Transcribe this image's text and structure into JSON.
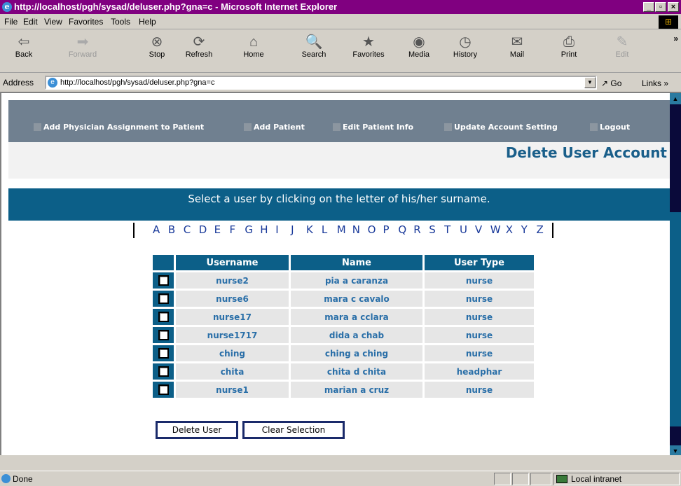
{
  "window": {
    "title": "http://localhost/pgh/sysad/deluser.php?gna=c - Microsoft Internet Explorer",
    "minimize": "_",
    "maximize": "▫",
    "close": "×"
  },
  "menu": [
    "File",
    "Edit",
    "View",
    "Favorites",
    "Tools",
    "Help"
  ],
  "toolbar": [
    {
      "label": "Back",
      "icon": "back-arrow-icon",
      "glyph": "⇦",
      "enabled": true
    },
    {
      "label": "Forward",
      "icon": "forward-arrow-icon",
      "glyph": "➡",
      "enabled": false
    },
    {
      "label": "Stop",
      "icon": "stop-icon",
      "glyph": "⊗",
      "enabled": true
    },
    {
      "label": "Refresh",
      "icon": "refresh-icon",
      "glyph": "⟳",
      "enabled": true
    },
    {
      "label": "Home",
      "icon": "home-icon",
      "glyph": "⌂",
      "enabled": true
    },
    {
      "label": "Search",
      "icon": "search-icon",
      "glyph": "🔍",
      "enabled": true
    },
    {
      "label": "Favorites",
      "icon": "favorites-icon",
      "glyph": "★",
      "enabled": true
    },
    {
      "label": "Media",
      "icon": "media-icon",
      "glyph": "◉",
      "enabled": true
    },
    {
      "label": "History",
      "icon": "history-icon",
      "glyph": "◷",
      "enabled": true
    },
    {
      "label": "Mail",
      "icon": "mail-icon",
      "glyph": "✉",
      "enabled": true
    },
    {
      "label": "Print",
      "icon": "print-icon",
      "glyph": "⎙",
      "enabled": true
    },
    {
      "label": "Edit",
      "icon": "edit-icon",
      "glyph": "✎",
      "enabled": false
    }
  ],
  "address": {
    "label": "Address",
    "url": "http://localhost/pgh/sysad/deluser.php?gna=c",
    "go": "Go",
    "links": "Links"
  },
  "nav": [
    "Add Physician Assignment to Patient",
    "Add Patient",
    "Edit Patient Info",
    "Update Account Setting",
    "Logout"
  ],
  "page_title": "Delete User Account",
  "instruction": "Select a user by clicking on the letter of his/her surname.",
  "letters": [
    "A",
    "B",
    "C",
    "D",
    "E",
    "F",
    "G",
    "H",
    "I",
    "J",
    "K",
    "L",
    "M",
    "N",
    "O",
    "P",
    "Q",
    "R",
    "S",
    "T",
    "U",
    "V",
    "W",
    "X",
    "Y",
    "Z"
  ],
  "table": {
    "headers": [
      "Username",
      "Name",
      "User Type"
    ],
    "rows": [
      {
        "username": "nurse2",
        "name": "pia a caranza",
        "type": "nurse",
        "checked": false
      },
      {
        "username": "nurse6",
        "name": "mara c cavalo",
        "type": "nurse",
        "checked": false
      },
      {
        "username": "nurse17",
        "name": "mara a cclara",
        "type": "nurse",
        "checked": false
      },
      {
        "username": "nurse1717",
        "name": "dida a chab",
        "type": "nurse",
        "checked": false
      },
      {
        "username": "ching",
        "name": "ching a ching",
        "type": "nurse",
        "checked": false
      },
      {
        "username": "chita",
        "name": "chita d chita",
        "type": "headphar",
        "checked": false
      },
      {
        "username": "nurse1",
        "name": "marian a cruz",
        "type": "nurse",
        "checked": false
      }
    ]
  },
  "buttons": {
    "delete": "Delete User",
    "clear": "Clear Selection"
  },
  "status": {
    "text": "Done",
    "zone": "Local intranet"
  },
  "colors": {
    "title_bar": "#800080",
    "nav_bg": "#708090",
    "band": "#0c5f88",
    "title_text": "#1a5f8a",
    "cell_text": "#2a6fa8"
  }
}
